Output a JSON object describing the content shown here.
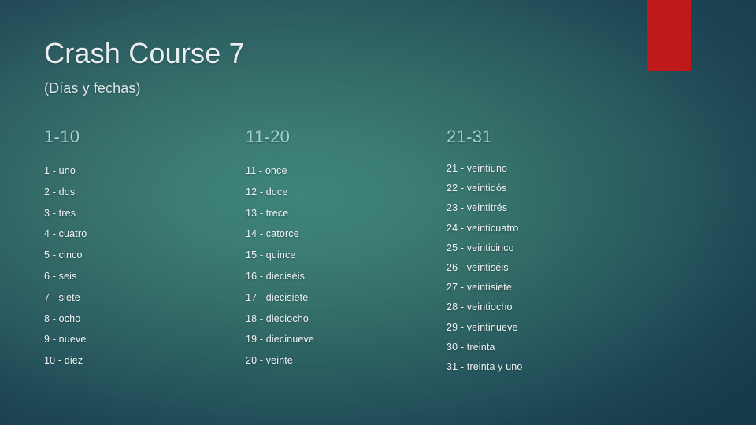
{
  "slide": {
    "title": "Crash Course 7",
    "subtitle": "(Días y fechas)",
    "accent_color": "#bf1a1a",
    "header_color": "#a6d2d6",
    "body_text_color": "#f2f6f7",
    "background_center_color": "#3e847a",
    "background_edge_color": "#1a4253"
  },
  "columns": [
    {
      "header": "1-10",
      "items": [
        "1 - uno",
        "2 - dos",
        "3 - tres",
        "4 - cuatro",
        "5 - cinco",
        "6 - seis",
        "7 - siete",
        "8 - ocho",
        "9 - nueve",
        "10 - diez"
      ]
    },
    {
      "header": "11-20",
      "items": [
        "11 - once",
        "12 - doce",
        "13 - trece",
        "14 - catorce",
        "15 - quince",
        "16 - dieciséis",
        "17 - diecisiete",
        "18 - dieciocho",
        "19 - diecinueve",
        "20 - veinte"
      ]
    },
    {
      "header": "21-31",
      "items": [
        "21 - veintiuno",
        "22 - veintidós",
        "23 - veintitrés",
        "24 - veinticuatro",
        "25 - veinticinco",
        "26 - veintiséis",
        "27 - veintisiete",
        "28 - veintiocho",
        "29 - veintinueve",
        "30 - treinta",
        "31 - treinta y uno"
      ]
    }
  ]
}
